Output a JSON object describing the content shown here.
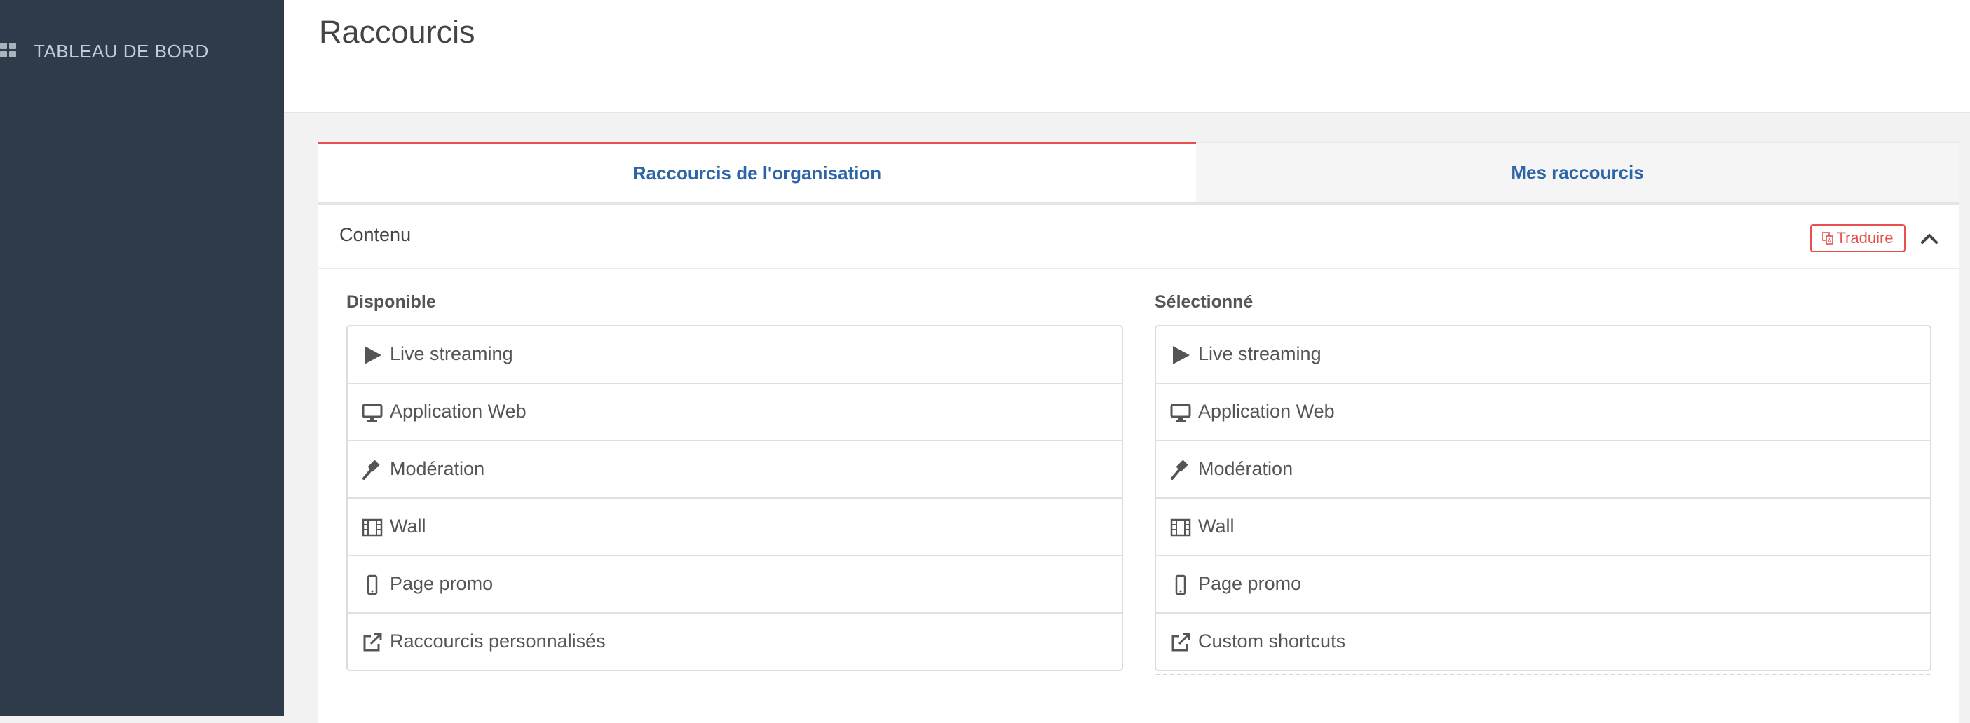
{
  "sidebar": {
    "items": [
      {
        "label": "TABLEAU DE BORD",
        "icon": "grid-icon"
      }
    ]
  },
  "header": {
    "title": "Raccourcis"
  },
  "tabs": [
    {
      "label": "Raccourcis de l'organisation",
      "active": true
    },
    {
      "label": "Mes raccourcis",
      "active": false
    }
  ],
  "panel": {
    "title": "Contenu",
    "translate_label": "Traduire",
    "available": {
      "title": "Disponible",
      "items": [
        {
          "label": "Live streaming",
          "icon": "play-icon"
        },
        {
          "label": "Application Web",
          "icon": "desktop-icon"
        },
        {
          "label": "Modération",
          "icon": "gavel-icon"
        },
        {
          "label": "Wall",
          "icon": "film-icon"
        },
        {
          "label": "Page promo",
          "icon": "mobile-icon"
        },
        {
          "label": "Raccourcis personnalisés",
          "icon": "external-link-icon"
        }
      ]
    },
    "selected": {
      "title": "Sélectionné",
      "items": [
        {
          "label": "Live streaming",
          "icon": "play-icon"
        },
        {
          "label": "Application Web",
          "icon": "desktop-icon"
        },
        {
          "label": "Modération",
          "icon": "gavel-icon"
        },
        {
          "label": "Wall",
          "icon": "film-icon"
        },
        {
          "label": "Page promo",
          "icon": "mobile-icon"
        },
        {
          "label": "Custom shortcuts",
          "icon": "external-link-icon"
        }
      ]
    }
  },
  "colors": {
    "sidebar_bg": "#2f3b4b",
    "accent_red": "#e84f4f",
    "tab_blue": "#2e65a6"
  }
}
